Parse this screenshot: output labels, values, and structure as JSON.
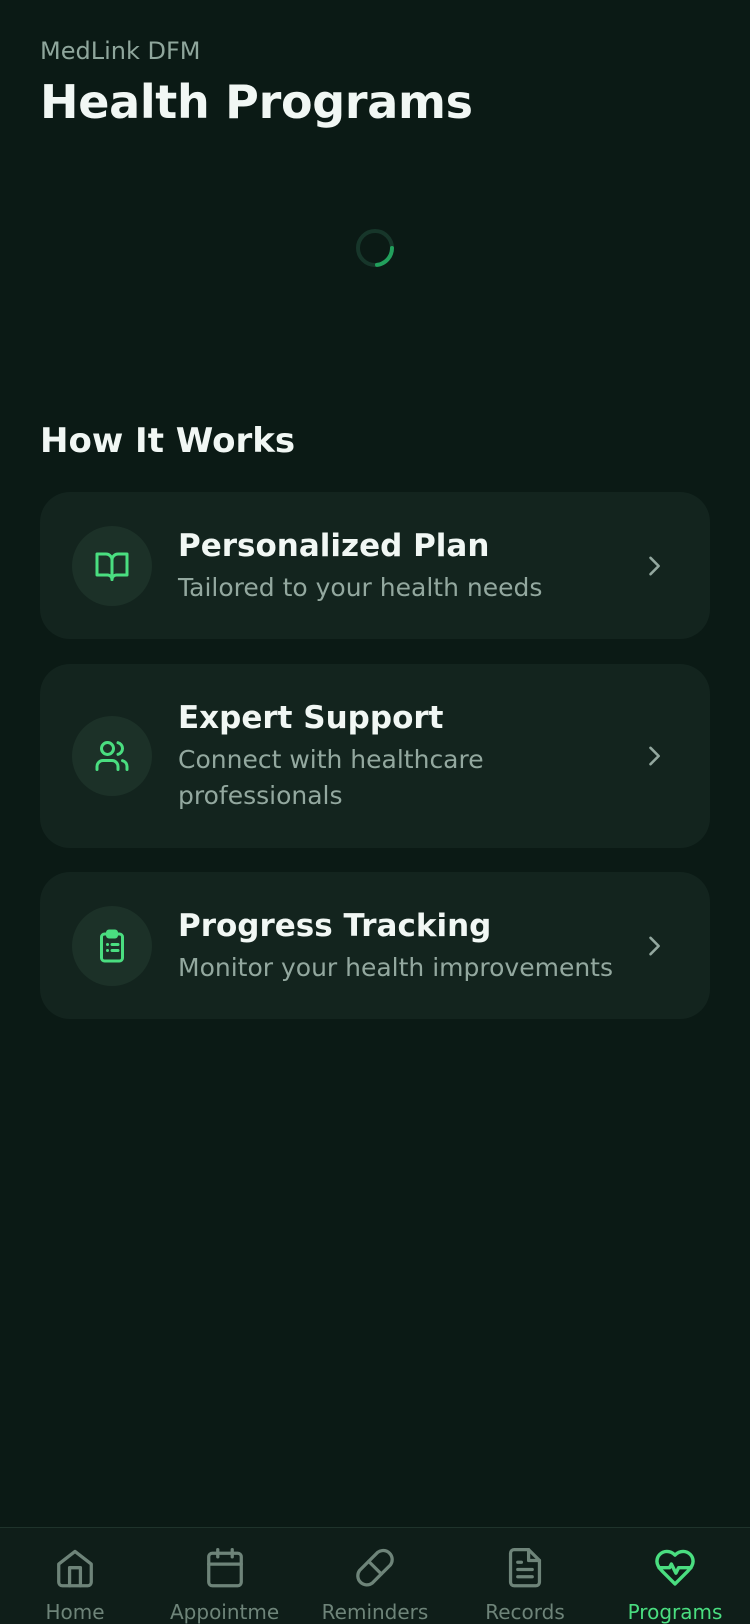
{
  "header": {
    "app_name": "MedLink DFM",
    "title": "Health Programs"
  },
  "section": {
    "title": "How It Works"
  },
  "cards": [
    {
      "title": "Personalized Plan",
      "description": "Tailored to your health needs",
      "icon": "book-open-icon"
    },
    {
      "title": "Expert Support",
      "description": "Connect with healthcare professionals",
      "icon": "users-icon"
    },
    {
      "title": "Progress Tracking",
      "description": "Monitor your health improvements",
      "icon": "clipboard-list-icon"
    }
  ],
  "tabbar": {
    "items": [
      {
        "label": "Home",
        "icon": "home-icon"
      },
      {
        "label": "Appointments",
        "icon": "calendar-icon"
      },
      {
        "label": "Reminders",
        "icon": "pill-icon"
      },
      {
        "label": "Records",
        "icon": "document-icon"
      },
      {
        "label": "Programs",
        "icon": "heart-pulse-icon",
        "active": true
      }
    ]
  },
  "colors": {
    "background": "#0b1a15",
    "card": "#13241e",
    "accent": "#4ade80",
    "muted_text": "#93a89f"
  }
}
